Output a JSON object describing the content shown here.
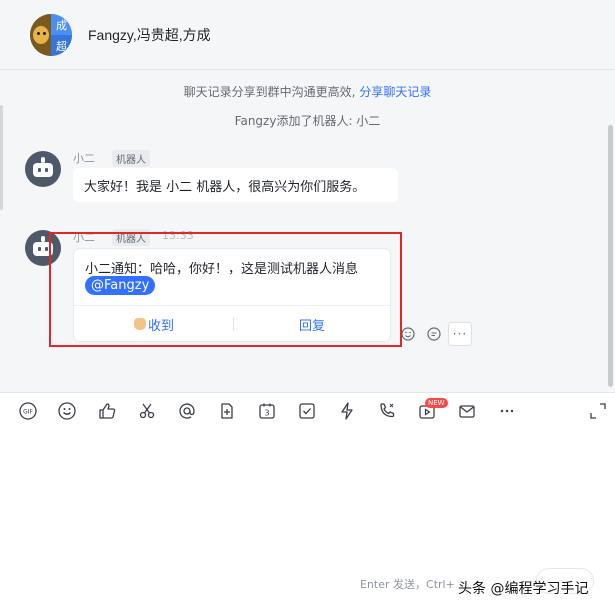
{
  "header": {
    "title": "Fangzy,冯贵超,方成",
    "avatar_chars": [
      "成",
      "超"
    ]
  },
  "system": {
    "share_text": "聊天记录分享到群中沟通更高效,",
    "share_link": "分享聊天记录",
    "added_text": "Fangzy添加了机器人: 小二"
  },
  "messages": [
    {
      "sender": "小二",
      "tag": "机器人",
      "text": "大家好！我是 小二 机器人，很高兴为你们服务。"
    },
    {
      "sender": "小二",
      "tag": "机器人",
      "time": "13:33",
      "text": "小二通知：哈哈，你好！，这是测试机器人消息",
      "mention": "@Fangzy",
      "buttons": [
        "收到",
        "回复"
      ]
    }
  ],
  "toolbar": {
    "new_badge": "NEW",
    "icons": [
      "gif-icon",
      "emoji-icon",
      "thumbs-up-icon",
      "scissors-icon",
      "at-icon",
      "file-plus-icon",
      "calendar-icon",
      "checkbox-icon",
      "lightning-icon",
      "phone-icon",
      "video-icon",
      "mail-icon",
      "more-icon",
      "expand-icon"
    ],
    "calendar_day": "3"
  },
  "input": {
    "hint": "Enter 发送，Ctrl+"
  },
  "watermark": "头条 @编程学习手记",
  "colors": {
    "accent": "#3370ff",
    "highlight": "#e02828",
    "badge": "#f54a45"
  }
}
